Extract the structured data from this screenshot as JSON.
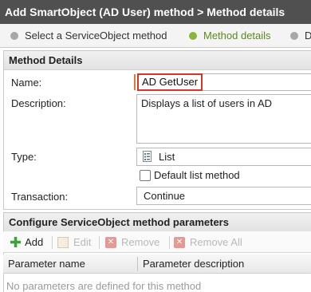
{
  "window": {
    "title": "Add SmartObject (AD User) method > Method details"
  },
  "wizard": {
    "steps": [
      {
        "label": "Select a ServiceObject method",
        "state": "inactive"
      },
      {
        "label": "Method details",
        "state": "active"
      },
      {
        "label": "De",
        "state": "inactive"
      }
    ]
  },
  "method_details": {
    "header": "Method Details",
    "name_label": "Name:",
    "name_value": "AD GetUser",
    "description_label": "Description:",
    "description_value": "Displays a list of users in AD",
    "type_label": "Type:",
    "type_value": "List",
    "type_icon": "list-icon",
    "default_list_label": "Default list method",
    "default_list_checked": false,
    "transaction_label": "Transaction:",
    "transaction_value": "Continue"
  },
  "parameters": {
    "header": "Configure ServiceObject method parameters",
    "toolbar": {
      "add_label": "Add",
      "edit_label": "Edit",
      "remove_label": "Remove",
      "remove_all_label": "Remove All"
    },
    "columns": [
      "Parameter name",
      "Parameter description"
    ],
    "empty_message": "No parameters are defined for this method"
  },
  "colors": {
    "title_bg": "#505050",
    "active_step": "#8ab43a",
    "name_highlight": "#d9342b",
    "add_icon": "#3aa43a"
  }
}
